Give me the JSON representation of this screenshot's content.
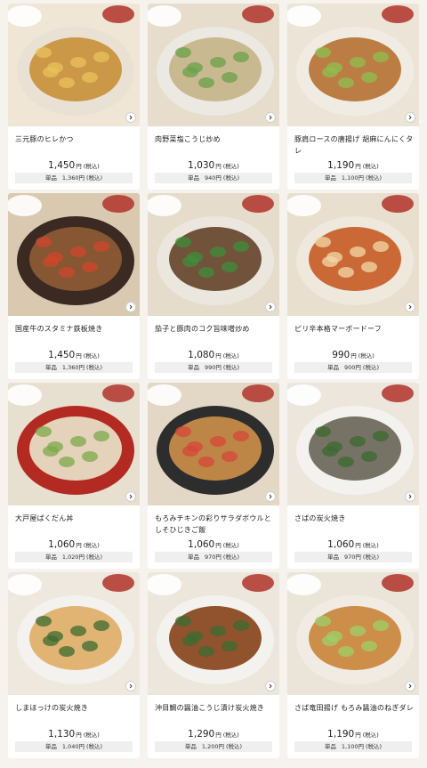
{
  "currency": "円",
  "tax_note": "(税込)",
  "single_label": "単品",
  "items": [
    {
      "name": "三元豚のヒレかつ",
      "price": "1,450",
      "single_price": "1,360",
      "photo": "hire-katsu",
      "plate": "#e9e2d4",
      "food": "#c9933f",
      "accent": "#e9c15a"
    },
    {
      "name": "肉野菜塩こうじ炒め",
      "price": "1,030",
      "single_price": "940",
      "photo": "stir-fry",
      "plate": "#ece9e2",
      "food": "#c7b68c",
      "accent": "#6aa24a"
    },
    {
      "name": "豚肩ロースの唐揚げ 胡麻にんにくタレ",
      "price": "1,190",
      "single_price": "1,100",
      "photo": "karaage",
      "plate": "#f1ece3",
      "food": "#b7773a",
      "accent": "#8fbf4d"
    },
    {
      "name": "国産牛のスタミナ鉄板焼き",
      "price": "1,450",
      "single_price": "1,360",
      "photo": "teppan",
      "plate": "#3b2a22",
      "food": "#8a5a34",
      "accent": "#d0462c"
    },
    {
      "name": "茄子と豚肉のコク旨味噌炒め",
      "price": "1,080",
      "single_price": "990",
      "photo": "nasu",
      "plate": "#ece7de",
      "food": "#6a4a32",
      "accent": "#3f8f3a"
    },
    {
      "name": "ピリ辛本格マーボードーフ",
      "price": "990",
      "single_price": "900",
      "photo": "mabo",
      "plate": "#eee8dd",
      "food": "#c8622c",
      "accent": "#f1d9a8"
    },
    {
      "name": "大戸屋ばくだん丼",
      "price": "1,060",
      "single_price": "1,020",
      "photo": "bakudan",
      "plate": "#b32a22",
      "food": "#e7dcc3",
      "accent": "#7ca84a"
    },
    {
      "name": "もろみチキンの彩りサラダボウルとしそひじきご飯",
      "price": "1,060",
      "single_price": "970",
      "photo": "chicken-bowl",
      "plate": "#2d2d2d",
      "food": "#c68b48",
      "accent": "#d6463a"
    },
    {
      "name": "さばの炭火焼き",
      "price": "1,060",
      "single_price": "970",
      "photo": "saba",
      "plate": "#f4f2ee",
      "food": "#6f6a5e",
      "accent": "#3c6b2f"
    },
    {
      "name": "しまほっけの炭火焼き",
      "price": "1,130",
      "single_price": "1,040",
      "photo": "hokke",
      "plate": "#f4f2ee",
      "food": "#e0b06b",
      "accent": "#3c6b2f"
    },
    {
      "name": "沖目鯛の醤油こうじ漬け炭火焼き",
      "price": "1,290",
      "single_price": "1,200",
      "photo": "okimedai",
      "plate": "#f4f2ee",
      "food": "#8a4a22",
      "accent": "#3c6b2f"
    },
    {
      "name": "さば竜田揚げ もろみ醤油のねぎダレ",
      "price": "1,190",
      "single_price": "1,100",
      "photo": "tatsuta",
      "plate": "#f1ece3",
      "food": "#c9893f",
      "accent": "#9fcf6a"
    }
  ]
}
